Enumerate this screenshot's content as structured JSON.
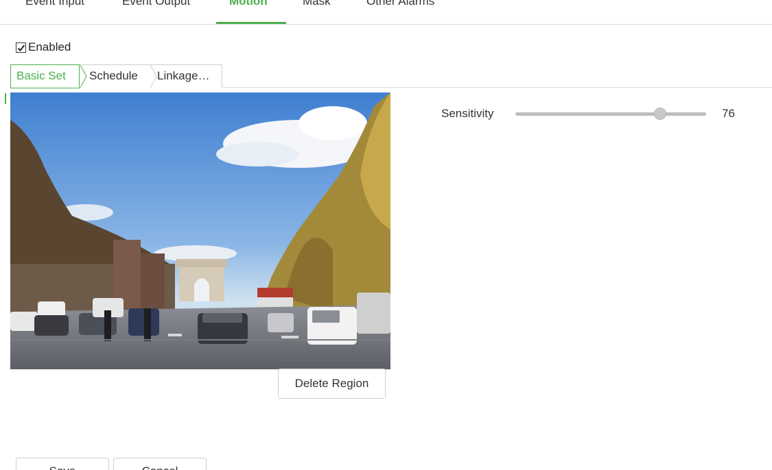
{
  "top_tabs": [
    {
      "label": "Event Input"
    },
    {
      "label": "Event Output"
    },
    {
      "label": "Motion",
      "active": true
    },
    {
      "label": "Mask"
    },
    {
      "label": "Other Alarms"
    }
  ],
  "enabled": {
    "label": "Enabled",
    "checked": true
  },
  "sub_tabs": [
    {
      "label": "Basic Set",
      "active": true
    },
    {
      "label": "Schedule"
    },
    {
      "label": "Linkage…"
    }
  ],
  "preview": {
    "icon": "camera-preview-image"
  },
  "buttons": {
    "delete_region": "Delete Region",
    "save": "Save",
    "cancel": "Cancel"
  },
  "sensitivity": {
    "label": "Sensitivity",
    "value": "76",
    "fraction": 0.76
  },
  "colors": {
    "accent": "#4cae4c",
    "border": "#cfcfcf"
  }
}
